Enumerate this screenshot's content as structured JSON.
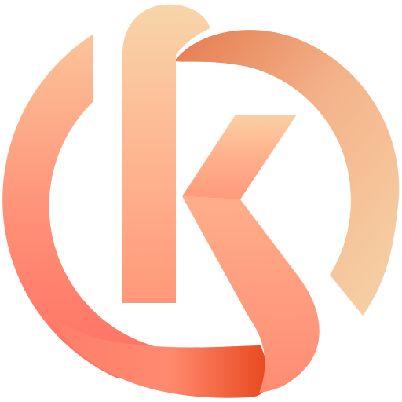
{
  "logo": {
    "name": "k-circle-logo-icon",
    "colors": {
      "peach_light": "#F7D3A8",
      "peach": "#FBC49A",
      "salmon": "#FF9B7E",
      "coral": "#FF7D6A",
      "coral_deep": "#F26A5A",
      "orange_red": "#E8481F",
      "burnt_orange": "#E57A4E"
    }
  }
}
